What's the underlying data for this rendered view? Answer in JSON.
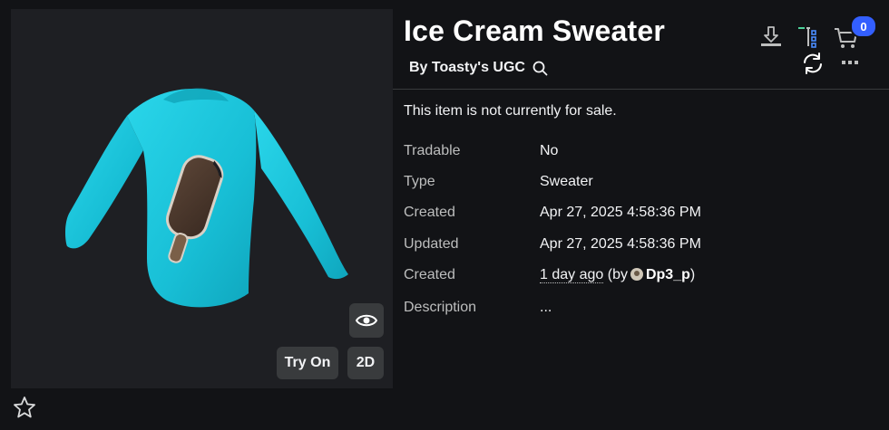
{
  "item": {
    "title": "Ice Cream Sweater",
    "creator": "By Toasty's UGC",
    "sale_note": "This item is not currently for sale."
  },
  "preview": {
    "try_on_label": "Try On",
    "two_d_label": "2D"
  },
  "cart": {
    "count": "0"
  },
  "details": {
    "tradable": {
      "label": "Tradable",
      "value": "No"
    },
    "type": {
      "label": "Type",
      "value": "Sweater"
    },
    "created": {
      "label": "Created",
      "value": "Apr 27, 2025 4:58:36 PM"
    },
    "updated": {
      "label": "Updated",
      "value": "Apr 27, 2025 4:58:36 PM"
    },
    "created_by": {
      "label": "Created",
      "ago": "1 day ago",
      "by_prefix": "(by",
      "user": "Dp3_p",
      "by_suffix": ")"
    },
    "description": {
      "label": "Description",
      "value": "..."
    }
  },
  "icons": {
    "download": "download-icon",
    "tree": "hierarchy-icon",
    "cart": "cart-icon",
    "refresh": "refresh-icon",
    "more": "more-icon",
    "search": "search-icon",
    "eye": "eye-icon",
    "favorite": "star-icon"
  },
  "colors": {
    "sweater": "#1cc7dc",
    "badge": "#335fff",
    "tree_accent": "#4cd19a"
  }
}
